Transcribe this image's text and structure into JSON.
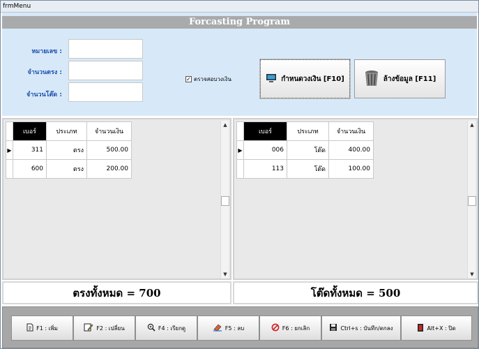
{
  "window": {
    "title": "frmMenu"
  },
  "header": {
    "banner": "Forcasting Program",
    "fields": [
      {
        "label": "หมายเลข :",
        "value": ""
      },
      {
        "label": "จำนวนตรง :",
        "value": ""
      },
      {
        "label": "จำนวนโต๊ด :",
        "value": ""
      }
    ],
    "checkbox": {
      "label": "ตรวจสอบวงเงิน",
      "checked": true,
      "mark": "✓"
    },
    "assign_button": {
      "label": "กำหนดวงเงิน [F10]",
      "icon": "computer-icon"
    },
    "clear_button": {
      "label": "ล้างข้อมูล [F11]",
      "icon": "trash-icon"
    }
  },
  "grid_left": {
    "columns": [
      "เบอร์",
      "ประเภท",
      "จำนวนเงิน"
    ],
    "rows": [
      {
        "number": "311",
        "type": "ตรง",
        "amount": "500.00"
      },
      {
        "number": "600",
        "type": "ตรง",
        "amount": "200.00"
      }
    ],
    "total": "ตรงทั้งหมด = 700"
  },
  "grid_right": {
    "columns": [
      "เบอร์",
      "ประเภท",
      "จำนวนเงิน"
    ],
    "rows": [
      {
        "number": "006",
        "type": "โต๊ด",
        "amount": "400.00"
      },
      {
        "number": "113",
        "type": "โต๊ด",
        "amount": "100.00"
      }
    ],
    "total": "โต๊ดทั้งหมด = 500"
  },
  "toolbar": {
    "buttons": [
      {
        "label": "F1 : เพิ่ม",
        "icon": "document-icon"
      },
      {
        "label": "F2 : เปลี่ยน",
        "icon": "edit-icon"
      },
      {
        "label": "F4 : เรียกดู",
        "icon": "zoom-icon"
      },
      {
        "label": "F5 : ลบ",
        "icon": "eraser-icon"
      },
      {
        "label": "F6 : ยกเลิก",
        "icon": "cancel-icon"
      },
      {
        "label": "Ctrl+s : บันทึก/ตกลง",
        "icon": "save-icon"
      },
      {
        "label": "Alt+X : ปิด",
        "icon": "exit-icon"
      }
    ]
  },
  "colors": {
    "header_bg": "#d7e9f8",
    "banner_bg": "#a9aaac",
    "label_blue": "#1d4fb0",
    "toolbar_bg": "#a7a7a7"
  }
}
